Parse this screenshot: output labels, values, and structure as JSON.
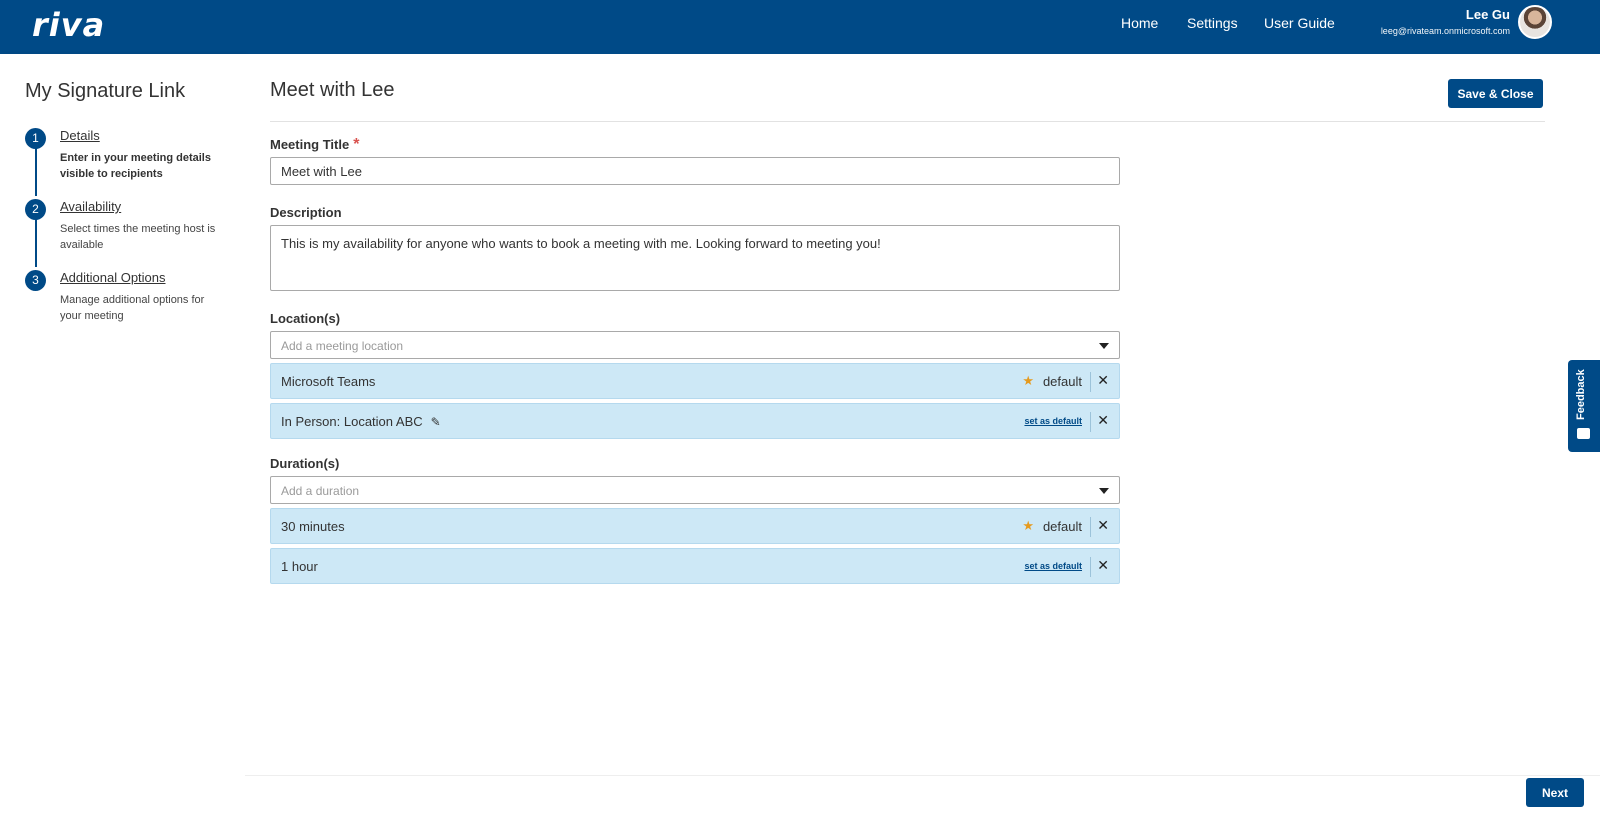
{
  "header": {
    "logo": "riva",
    "nav": [
      "Home",
      "Settings",
      "User Guide"
    ],
    "user_name": "Lee Gu",
    "user_email": "leeg@rivateam.onmicrosoft.com"
  },
  "sidebar": {
    "title": "My Signature Link",
    "steps": [
      {
        "number": "1",
        "label": "Details",
        "description": "Enter in your meeting details visible to recipients"
      },
      {
        "number": "2",
        "label": "Availability",
        "description": "Select times the meeting host is available"
      },
      {
        "number": "3",
        "label": "Additional Options",
        "description": "Manage additional options for your meeting"
      }
    ]
  },
  "main": {
    "title": "Meet with Lee",
    "save_label": "Save & Close",
    "meeting_title": {
      "label": "Meeting Title",
      "required_mark": "*",
      "value": "Meet with Lee"
    },
    "description": {
      "label": "Description",
      "value": "This is my availability for anyone who wants to book a meeting with me. Looking forward to meeting you!"
    },
    "locations": {
      "label": "Location(s)",
      "placeholder": "Add a meeting location",
      "items": [
        {
          "label": "Microsoft Teams",
          "default": true,
          "default_label": "default"
        },
        {
          "label": "In Person: Location ABC",
          "default": false,
          "set_default_label": "set as default"
        }
      ]
    },
    "durations": {
      "label": "Duration(s)",
      "placeholder": "Add a duration",
      "items": [
        {
          "label": "30 minutes",
          "default": true,
          "default_label": "default"
        },
        {
          "label": "1 hour",
          "default": false,
          "set_default_label": "set as default"
        }
      ]
    }
  },
  "footer": {
    "next_label": "Next"
  },
  "feedback": {
    "label": "Feedback"
  },
  "colors": {
    "brand": "#004a87",
    "chip_bg": "#cde8f6",
    "star": "#e59a1e",
    "required": "#d9534f"
  }
}
